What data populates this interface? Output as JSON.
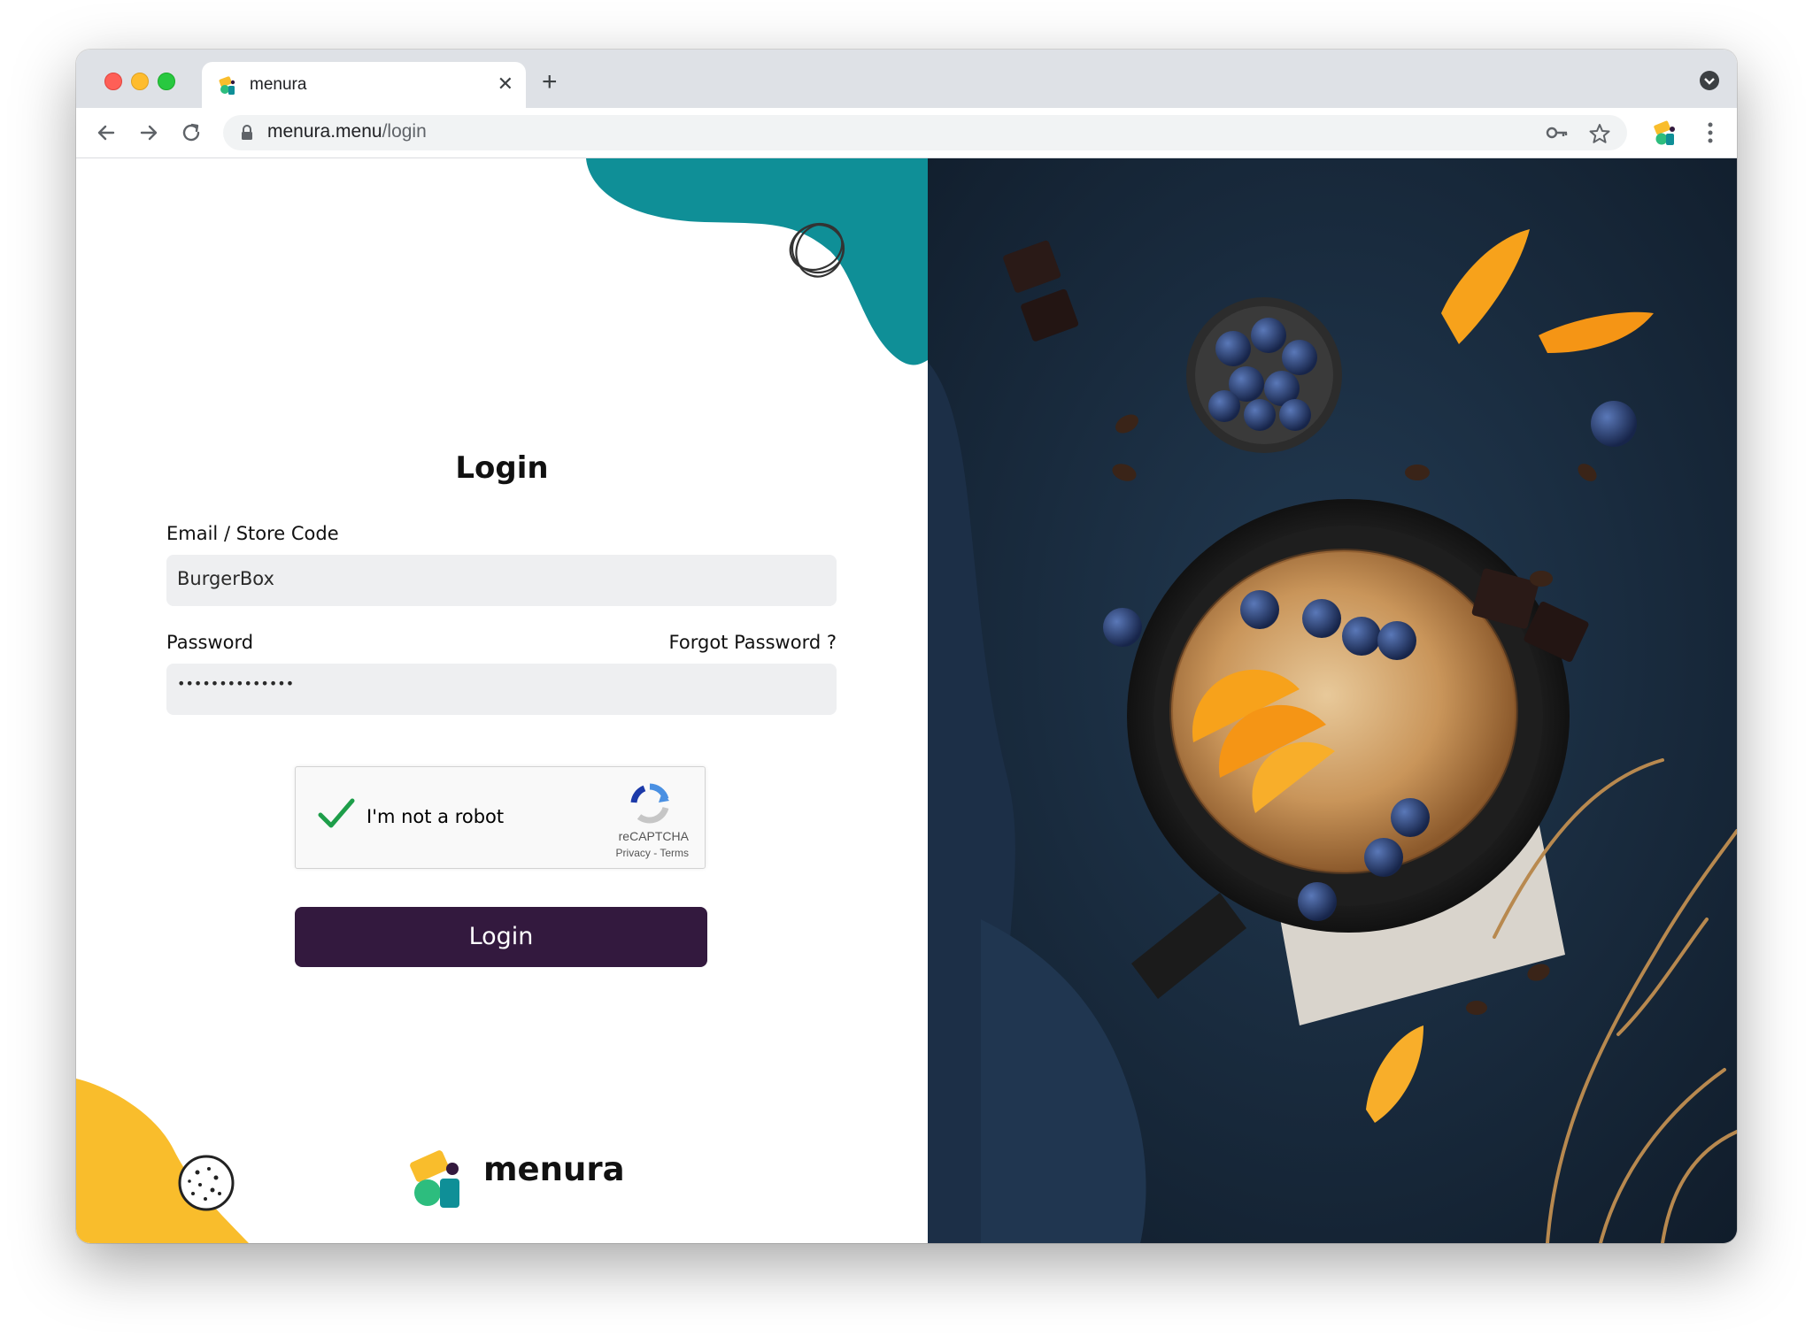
{
  "browser": {
    "tab_title": "menura",
    "tab_close": "✕",
    "new_tab": "+",
    "url_host": "menura.menu",
    "url_path": "/login"
  },
  "login": {
    "heading": "Login",
    "email_label": "Email / Store Code",
    "email_value": "BurgerBox",
    "password_label": "Password",
    "forgot_link": "Forgot Password ?",
    "password_value": "••••••••••••••",
    "captcha_label": "I'm not a robot",
    "captcha_brand": "reCAPTCHA",
    "captcha_privacy": "Privacy",
    "captcha_sep": " - ",
    "captcha_terms": "Terms",
    "submit_label": "Login"
  },
  "brand": {
    "name": "menura"
  },
  "colors": {
    "accent_teal": "#0f8f97",
    "accent_yellow": "#f9bd2c",
    "button_dark": "#33193e",
    "panel_dark": "#1a2a3c"
  },
  "icons": [
    "back-arrow-icon",
    "forward-arrow-icon",
    "reload-icon",
    "lock-icon",
    "key-icon",
    "star-icon",
    "menura-extension-icon",
    "more-vert-icon",
    "recaptcha-icon",
    "checkmark-icon"
  ]
}
